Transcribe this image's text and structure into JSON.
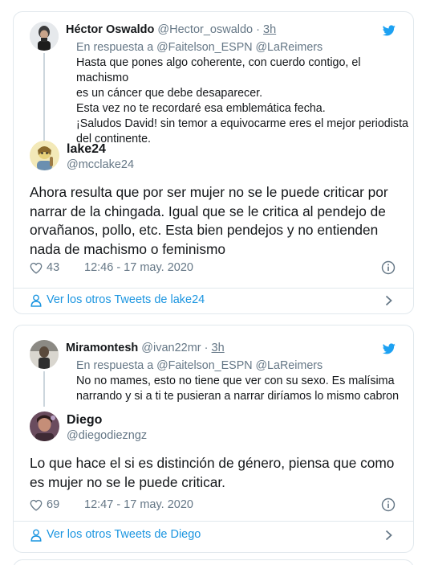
{
  "tweets": [
    {
      "parent": {
        "name": "Héctor Oswaldo",
        "handle": "@Hector_oswaldo",
        "dot": "·",
        "time": "3h",
        "reply_prefix": "En respuesta a",
        "reply_mentions": "@Faitelson_ESPN @LaReimers",
        "text": "Hasta que pones algo coherente, con cuerdo contigo, el machismo\nes un cáncer que debe desaparecer.\nEsta vez no te recordaré esa emblemática fecha.\n¡Saludos David! sin temor a equivocarme eres el mejor periodista\ndel continente."
      },
      "author": {
        "name": "lake24",
        "handle": "@mcclake24"
      },
      "text": "Ahora resulta que por ser mujer no se le puede criticar por narrar de la chingada. Igual que se le critica al pendejo de orvañanos, pollo, etc. Esta bien pendejos y no entienden nada de machismo o feminismo",
      "likes": "43",
      "timestamp": "12:46 - 17 may. 2020",
      "more_label": "Ver los otros Tweets de lake24"
    },
    {
      "parent": {
        "name": "Miramontesh",
        "handle": "@ivan22mr",
        "dot": "·",
        "time": "3h",
        "reply_prefix": "En respuesta a",
        "reply_mentions": "@Faitelson_ESPN @LaReimers",
        "text": "No no mames, esto no tiene que ver con su sexo. Es malísima\nnarrando y si a ti te pusieran a narrar diríamos lo mismo cabron"
      },
      "author": {
        "name": "Diego",
        "handle": "@diegodiezngz"
      },
      "text": "Lo que hace el si es distinción de género, piensa que como es mujer no se le puede criticar.",
      "likes": "69",
      "timestamp": "12:47 - 17 may. 2020",
      "more_label": "Ver los otros Tweets de Diego"
    }
  ],
  "colors": {
    "brand_blue": "#1da1f2",
    "link_blue": "#1b95e0",
    "secondary_text": "#657786",
    "border": "#e1e8ed"
  },
  "icons": [
    "twitter-bird-icon",
    "heart-icon",
    "info-icon",
    "user-icon",
    "chevron-right-icon"
  ]
}
